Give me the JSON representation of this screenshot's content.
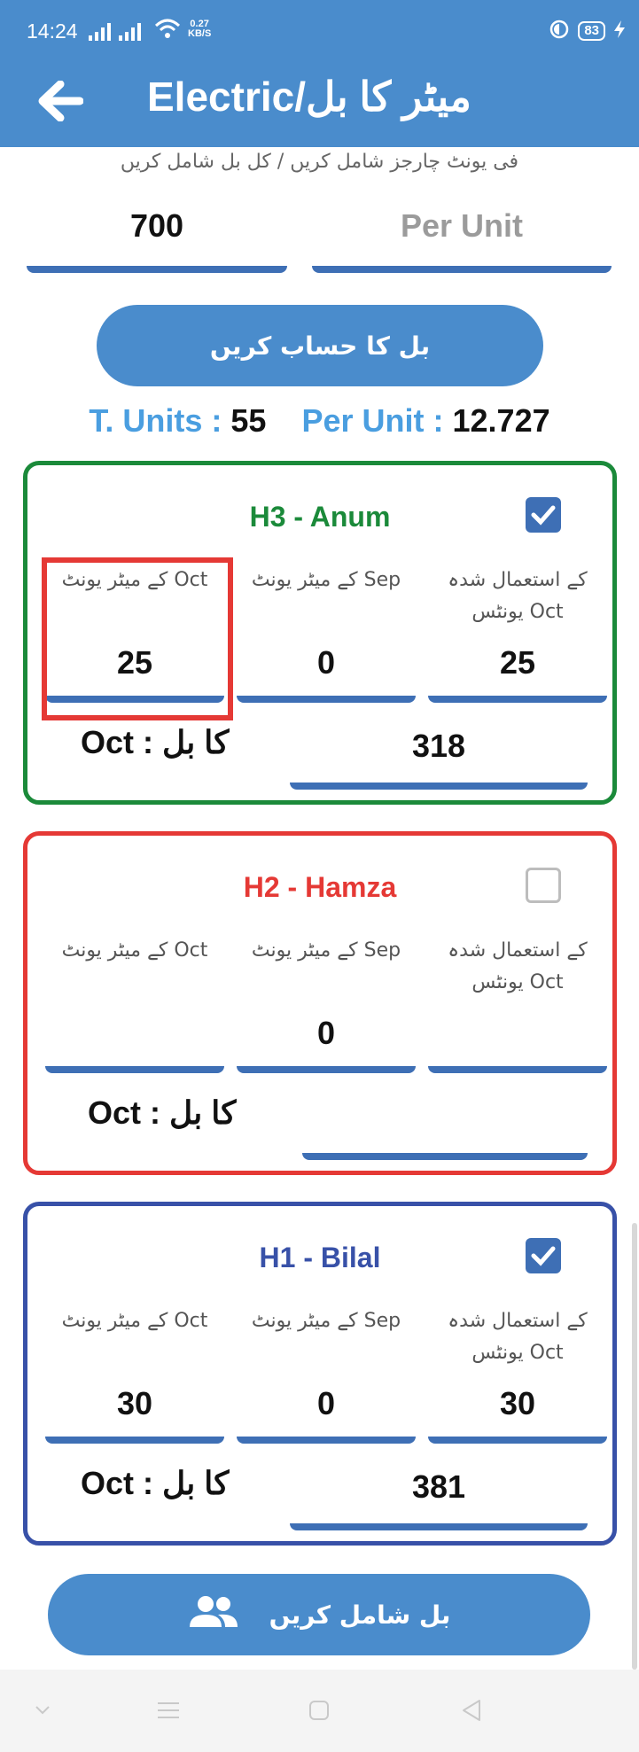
{
  "status_bar": {
    "time": "14:24",
    "speed": "0.27",
    "speed_unit": "KB/S",
    "battery": "83"
  },
  "header": {
    "title": "Electric/میٹر کا بل"
  },
  "form": {
    "helper_text": "فی یونٹ چارجز شامل کریں / کل بل شامل کریں",
    "total_bill_value": "700",
    "per_unit_placeholder": "Per Unit",
    "calculate_button": "بل کا حساب کریں"
  },
  "totals": {
    "units_label": "T. Units :",
    "units_value": "55",
    "per_unit_label": "Per Unit :",
    "per_unit_value": "12.727"
  },
  "cards": [
    {
      "title": "H3 - Anum",
      "color": "#1b8a3a",
      "checked": true,
      "col1_caption": "کے میٹر یونٹ Oct",
      "col2_caption": "کے میٹر یونٹ Sep",
      "col3_caption": "کے استعمال شدہ یونٹس Oct",
      "oct_units": "25",
      "sep_units": "0",
      "used_units": "25",
      "bill_label": "Oct : کا بل",
      "bill_value": "318"
    },
    {
      "title": "H2 - Hamza",
      "color": "#e53935",
      "checked": false,
      "col1_caption": "کے میٹر یونٹ Oct",
      "col2_caption": "کے میٹر یونٹ Sep",
      "col3_caption": "کے استعمال شدہ یونٹس Oct",
      "oct_units": "",
      "sep_units": "0",
      "used_units": "",
      "bill_label": "Oct : کا بل",
      "bill_value": ""
    },
    {
      "title": "H1 - Bilal",
      "color": "#3851a8",
      "checked": true,
      "col1_caption": "کے میٹر یونٹ Oct",
      "col2_caption": "کے میٹر یونٹ Sep",
      "col3_caption": "کے استعمال شدہ یونٹس Oct",
      "oct_units": "30",
      "sep_units": "0",
      "used_units": "30",
      "bill_label": "Oct : کا بل",
      "bill_value": "381"
    }
  ],
  "add_bill_button": "بل شامل کریں",
  "icons": {
    "back": "arrow-left-icon",
    "people": "people-icon",
    "checkbox": "checkbox-icon"
  }
}
